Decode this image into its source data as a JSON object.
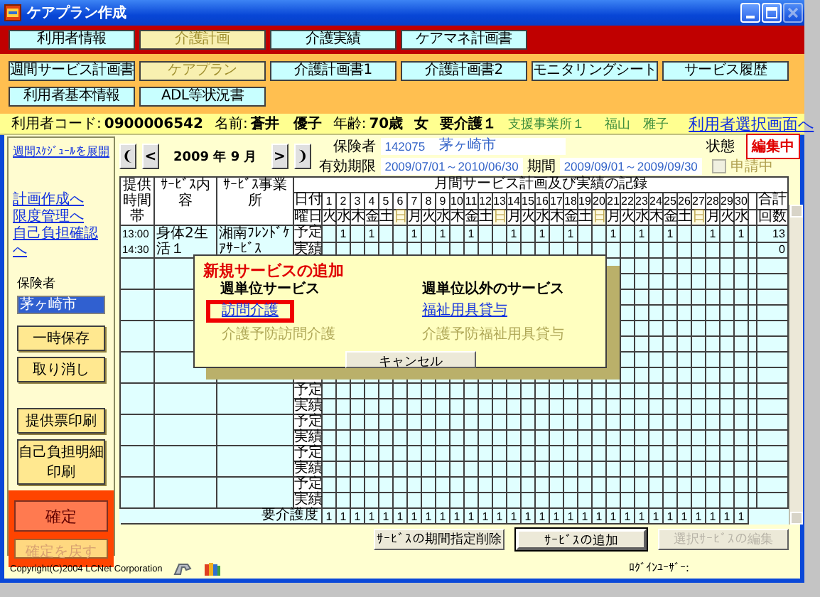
{
  "window": {
    "title": "ケアプラン作成"
  },
  "main_tabs": [
    {
      "label": "利用者情報",
      "selected": false
    },
    {
      "label": "介護計画",
      "selected": true
    },
    {
      "label": "介護実績",
      "selected": false
    },
    {
      "label": "ケアマネ計画書",
      "selected": false
    }
  ],
  "sub_tabs": [
    {
      "label": "週間サービス計画書",
      "selected": false
    },
    {
      "label": "ケアプラン",
      "selected": true
    },
    {
      "label": "介護計画書1",
      "selected": false
    },
    {
      "label": "介護計画書2",
      "selected": false
    },
    {
      "label": "モニタリングシート",
      "selected": false
    },
    {
      "label": "サービス履歴",
      "selected": false
    },
    {
      "label": "利用者基本情報",
      "selected": false
    },
    {
      "label": "ADL等状況書",
      "selected": false
    }
  ],
  "client": {
    "code_label": "利用者コード:",
    "code": "0900006542",
    "name_label": "名前:",
    "name": "蒼井　優子",
    "age_label": "年齢:",
    "age": "70歳",
    "sex": "女",
    "care_level": "要介護１",
    "office": "支援事業所１",
    "manager": "福山　雅子",
    "link": "利用者選択画面へ"
  },
  "sidebar": {
    "schedule_link": "週間ｽｹｼﾞｭｰﾙを展開",
    "links": [
      "計画作成へ",
      "限度管理へ",
      "自己負担確認へ"
    ],
    "insurer_label": "保険者",
    "insurers": [
      {
        "label": "茅ヶ崎市",
        "selected": true
      }
    ],
    "buttons": [
      "一時保存",
      "取り消し"
    ],
    "print_buttons": [
      "提供票印刷",
      "自己負担明細印刷"
    ],
    "confirm": {
      "label": "確定",
      "disabled": false
    },
    "unconfirm": {
      "label": "確定を戻す",
      "disabled": true
    }
  },
  "period": {
    "nav": [
      {
        "kind": "first",
        "label": "❨"
      },
      {
        "kind": "prev",
        "label": "<"
      },
      {
        "kind": "month",
        "label": "2009 年 9 月"
      },
      {
        "kind": "next",
        "label": ">"
      },
      {
        "kind": "last",
        "label": "❩"
      }
    ],
    "insurer_label": "保険者",
    "insurer_code": "142075",
    "insurer_name": "茅ヶ崎市",
    "valid_label": "有効期限",
    "valid": "2009/07/01～2010/06/30",
    "period_label": "期間",
    "period": "2009/09/01～2009/09/30",
    "applying": {
      "label": "申請中",
      "checked": false,
      "disabled": true
    },
    "status_label": "状態",
    "status": "編集中"
  },
  "schedule": {
    "headers": [
      "提供時間帯",
      "ｻｰﾋﾞｽ内容",
      "ｻｰﾋﾞｽ事業所"
    ],
    "title": "月間サービス計画及び実績の記録",
    "date_label": "日付",
    "weekday_label": "曜日",
    "total_label": "合計",
    "count_label": "回数",
    "days": [
      {
        "date": "1",
        "weekday": "火",
        "sunday": false
      },
      {
        "date": "2",
        "weekday": "水",
        "sunday": false
      },
      {
        "date": "3",
        "weekday": "木",
        "sunday": false
      },
      {
        "date": "4",
        "weekday": "金",
        "sunday": false
      },
      {
        "date": "5",
        "weekday": "土",
        "sunday": false
      },
      {
        "date": "6",
        "weekday": "日",
        "sunday": true
      },
      {
        "date": "7",
        "weekday": "月",
        "sunday": false
      },
      {
        "date": "8",
        "weekday": "火",
        "sunday": false
      },
      {
        "date": "9",
        "weekday": "水",
        "sunday": false
      },
      {
        "date": "10",
        "weekday": "木",
        "sunday": false
      },
      {
        "date": "11",
        "weekday": "金",
        "sunday": false
      },
      {
        "date": "12",
        "weekday": "土",
        "sunday": false
      },
      {
        "date": "13",
        "weekday": "日",
        "sunday": true
      },
      {
        "date": "14",
        "weekday": "月",
        "sunday": false
      },
      {
        "date": "15",
        "weekday": "火",
        "sunday": false
      },
      {
        "date": "16",
        "weekday": "水",
        "sunday": false
      },
      {
        "date": "17",
        "weekday": "木",
        "sunday": false
      },
      {
        "date": "18",
        "weekday": "金",
        "sunday": false
      },
      {
        "date": "19",
        "weekday": "土",
        "sunday": false
      },
      {
        "date": "20",
        "weekday": "日",
        "sunday": true
      },
      {
        "date": "21",
        "weekday": "月",
        "sunday": false
      },
      {
        "date": "22",
        "weekday": "火",
        "sunday": false
      },
      {
        "date": "23",
        "weekday": "水",
        "sunday": false
      },
      {
        "date": "24",
        "weekday": "木",
        "sunday": false
      },
      {
        "date": "25",
        "weekday": "金",
        "sunday": false
      },
      {
        "date": "26",
        "weekday": "土",
        "sunday": false
      },
      {
        "date": "27",
        "weekday": "日",
        "sunday": true
      },
      {
        "date": "28",
        "weekday": "月",
        "sunday": false
      },
      {
        "date": "29",
        "weekday": "火",
        "sunday": false
      },
      {
        "date": "30",
        "weekday": "水",
        "sunday": false
      }
    ],
    "slots": [
      {
        "kind": "entry",
        "time": "13:00 14:30",
        "service": "身体2生活１",
        "provider": "湘南ﾌﾚﾝﾄﾞｹｱｻｰﾋﾞｽ",
        "plan_label": "予定",
        "actual_label": "実績",
        "plan": [
          {
            "kind": "empty"
          },
          {
            "kind": "count",
            "value": "1"
          },
          {
            "kind": "empty"
          },
          {
            "kind": "count",
            "value": "1"
          },
          {
            "kind": "empty"
          },
          {
            "kind": "empty"
          },
          {
            "kind": "count",
            "value": "1"
          },
          {
            "kind": "empty"
          },
          {
            "kind": "count",
            "value": "1"
          },
          {
            "kind": "empty"
          },
          {
            "kind": "count",
            "value": "1"
          },
          {
            "kind": "empty"
          },
          {
            "kind": "empty"
          },
          {
            "kind": "count",
            "value": "1"
          },
          {
            "kind": "empty"
          },
          {
            "kind": "count",
            "value": "1"
          },
          {
            "kind": "empty"
          },
          {
            "kind": "count",
            "value": "1"
          },
          {
            "kind": "empty"
          },
          {
            "kind": "empty"
          },
          {
            "kind": "count",
            "value": "1"
          },
          {
            "kind": "empty"
          },
          {
            "kind": "count",
            "value": "1"
          },
          {
            "kind": "empty"
          },
          {
            "kind": "count",
            "value": "1"
          },
          {
            "kind": "empty"
          },
          {
            "kind": "empty"
          },
          {
            "kind": "count",
            "value": "1"
          },
          {
            "kind": "empty"
          },
          {
            "kind": "count",
            "value": "1"
          }
        ],
        "plan_total": "13",
        "actual_total": "0"
      },
      {
        "kind": "covered"
      },
      {
        "kind": "covered"
      },
      {
        "kind": "covered"
      },
      {
        "kind": "covered"
      },
      {
        "kind": "blank",
        "plan_label": "予定",
        "actual_label": "実績"
      },
      {
        "kind": "blank",
        "plan_label": "予定",
        "actual_label": "実績"
      },
      {
        "kind": "blank",
        "plan_label": "予定",
        "actual_label": "実績"
      },
      {
        "kind": "blank",
        "plan_label": "予定",
        "actual_label": "実績"
      }
    ],
    "care_level_label": "要介護度",
    "care_levels": [
      "1",
      "1",
      "1",
      "1",
      "1",
      "1",
      "1",
      "1",
      "1",
      "1",
      "1",
      "1",
      "1",
      "1",
      "1",
      "1",
      "1",
      "1",
      "1",
      "1",
      "1",
      "1",
      "1",
      "1",
      "1",
      "1",
      "1",
      "1",
      "1",
      "1"
    ]
  },
  "dialog": {
    "title": "新規サービスの追加",
    "groups": [
      {
        "heading": "週単位サービス",
        "items": [
          {
            "label": "訪問介護",
            "disabled": false,
            "highlighted": true
          },
          {
            "label": "介護予防訪問介護",
            "disabled": true,
            "highlighted": false
          }
        ]
      },
      {
        "heading": "週単位以外のサービス",
        "items": [
          {
            "label": "福祉用具貸与",
            "disabled": false,
            "highlighted": false
          },
          {
            "label": "介護予防福祉用具貸与",
            "disabled": true,
            "highlighted": false
          }
        ]
      }
    ],
    "cancel": "キャンセル"
  },
  "actions": [
    {
      "label": "ｻｰﾋﾞｽの期間指定削除",
      "disabled": false,
      "default": false
    },
    {
      "label": "ｻｰﾋﾞｽの追加",
      "disabled": false,
      "default": true
    },
    {
      "label": "選択ｻｰﾋﾞｽの編集",
      "disabled": true,
      "default": false
    }
  ],
  "footer": {
    "copyright": "Copyright(C)2004 LCNet Corporation",
    "login_label": "ﾛｸﾞｲﾝﾕｰｻﾞｰ:"
  }
}
